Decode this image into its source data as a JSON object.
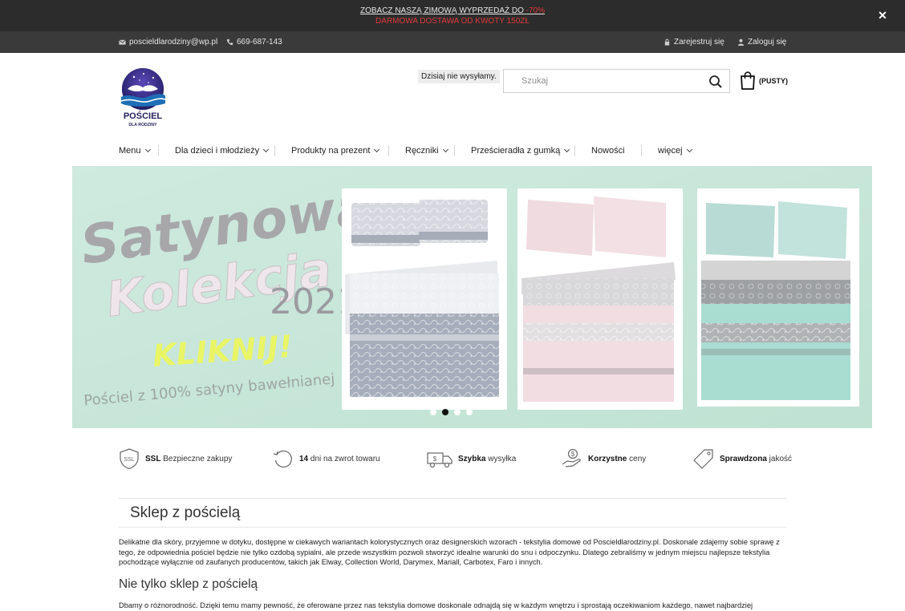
{
  "promo": {
    "line1_text": "ZOBACZ NASZĄ ZIMOWĄ WYPRZEDAŻ DO ",
    "line1_highlight": "-70%",
    "line2": "DARMOWA DOSTAWA OD KWOTY 150ZŁ",
    "close_icon": "close-icon"
  },
  "topbar": {
    "email": "poscieldlarodziny@wp.pl",
    "phone": "669-687-143",
    "register": "Zarejestruj się",
    "login": "Zaloguj się"
  },
  "header": {
    "logo_text": "POŚCIEL",
    "logo_subtext": "DLA RODZINY",
    "notice": "Dzisiaj nie wysyłamy.",
    "search_placeholder": "Szukaj",
    "cart_label": "(PUSTY)"
  },
  "nav": {
    "items": [
      {
        "label": "Menu"
      },
      {
        "label": "Dla dzieci i młodzieży"
      },
      {
        "label": "Produkty na prezent"
      },
      {
        "label": "Ręczniki"
      },
      {
        "label": "Prześcieradła z gumką"
      },
      {
        "label": "Nowości"
      },
      {
        "label": "więcej"
      }
    ]
  },
  "banner": {
    "title1": "Satynowa",
    "title2": "Kolekcja",
    "year": "2021",
    "cta": "KLIKNIJ!",
    "tagline": "Pościel z 100% satyny bawełnianej",
    "active_slide": 2,
    "slide_count": 4
  },
  "features": [
    {
      "bold": "SSL",
      "text": " Bezpieczne zakupy",
      "icon": "ssl-shield-icon"
    },
    {
      "bold": "14",
      "text": " dni na zwrot towaru",
      "icon": "return-icon"
    },
    {
      "bold": "Szybka",
      "text": " wysyłka",
      "icon": "delivery-truck-icon"
    },
    {
      "bold": "Korzystne",
      "text": " ceny",
      "icon": "money-hand-icon"
    },
    {
      "bold": "Sprawdzona",
      "text": " jakość",
      "icon": "tag-icon"
    }
  ],
  "content": {
    "heading": "Sklep z pościelą",
    "paragraph": "Delikatne dla skóry, przyjemne w dotyku, dostępne w ciekawych wariantach kolorystycznych oraz designerskich wzorach - tekstylia domowe od Poscieldlarodziny.pl. Doskonale zdajemy sobie sprawę z tego, że odpowiednia pościel będzie nie tylko ozdobą sypialni, ale przede wszystkim pozwoli stworzyć idealne warunki do snu i odpoczynku. Dlatego zebraliśmy w jednym miejscu najlepsze tekstylia pochodzące wyłącznie od zaufanych producentów, takich jak Elway, Collection World, Darymex, Mariall, Carbotex, Faro i innych.",
    "subheading": "Nie tylko sklep z pościelą",
    "paragraph2": "Dbamy o różnorodność. Dzięki temu mamy pewność, że oferowane przez nas tekstylia domowe doskonale odnajdą się w każdym wnętrzu i sprostają oczekiwaniom każdego, nawet najbardziej"
  }
}
